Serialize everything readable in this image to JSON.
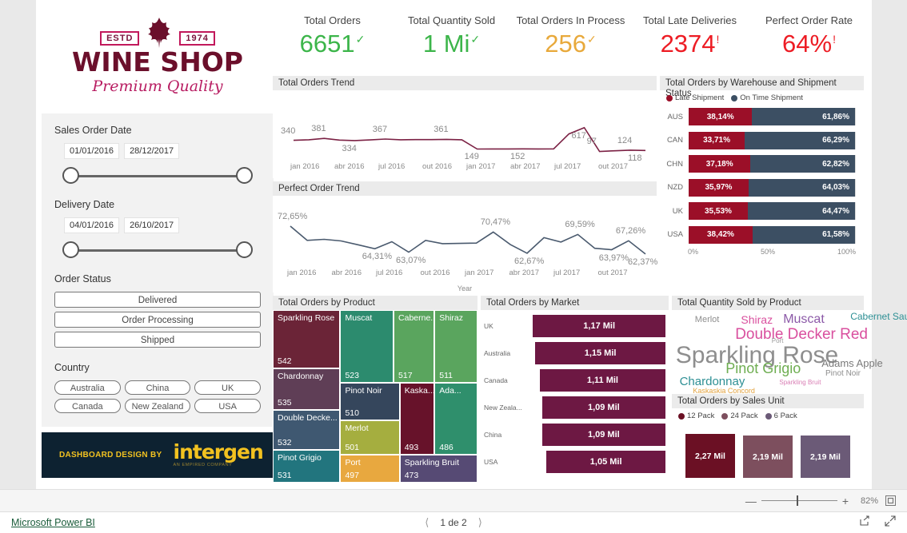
{
  "logo": {
    "estd": "ESTD",
    "year": "1974",
    "name": "WINE SHOP",
    "tagline": "Premium Quality",
    "leaf_icon": "leaf-icon",
    "color": "#6b0f2b",
    "accent": "#b81d62"
  },
  "filters": {
    "sales_order_date": {
      "label": "Sales Order Date",
      "start": "01/01/2016",
      "end": "28/12/2017"
    },
    "delivery_date": {
      "label": "Delivery Date",
      "start": "04/01/2016",
      "end": "26/10/2017"
    },
    "order_status": {
      "label": "Order Status",
      "options": [
        "Delivered",
        "Order Processing",
        "Shipped"
      ]
    },
    "country": {
      "label": "Country",
      "options": [
        "Australia",
        "China",
        "UK",
        "Canada",
        "New Zealand",
        "USA"
      ]
    }
  },
  "credit": {
    "prefix": "DASHBOARD DESIGN BY",
    "brand": "intergen",
    "sub": "AN EMPIRED COMPANY"
  },
  "kpis": [
    {
      "title": "Total Orders",
      "value": "6651",
      "flag": "check",
      "color": "#3cb54a"
    },
    {
      "title": "Total Quantity Sold",
      "value": "1 Mi",
      "flag": "check",
      "color": "#3cb54a"
    },
    {
      "title": "Total Orders In Process",
      "value": "256",
      "flag": "check",
      "color": "#e8a93b"
    },
    {
      "title": "Total Late Deliveries",
      "value": "2374",
      "flag": "alert",
      "color": "#ed1c24"
    },
    {
      "title": "Perfect Order Rate",
      "value": "64%",
      "flag": "alert",
      "color": "#ed1c24"
    }
  ],
  "chart_data": [
    {
      "type": "line",
      "title": "Total Orders Trend",
      "xlabel": "",
      "ylabel": "",
      "line_color": "#7b2144",
      "categories": [
        "jan 2016",
        "fev 2016",
        "mar 2016",
        "abr 2016",
        "mai 2016",
        "jun 2016",
        "jul 2016",
        "ago 2016",
        "set 2016",
        "out 2016",
        "nov 2016",
        "dez 2016",
        "jan 2017",
        "fev 2017",
        "mar 2017",
        "abr 2017",
        "mai 2017",
        "jun 2017",
        "jul 2017",
        "ago 2017",
        "set 2017",
        "out 2017",
        "nov 2017",
        "dez 2017"
      ],
      "tick_labels": [
        "jan 2016",
        "abr 2016",
        "jul 2016",
        "out 2016",
        "jan 2017",
        "abr 2017",
        "jul 2017",
        "out 2017"
      ],
      "values": [
        340,
        352,
        381,
        345,
        334,
        348,
        367,
        352,
        355,
        356,
        361,
        352,
        149,
        151,
        150,
        152,
        151,
        152,
        480,
        617,
        97,
        110,
        124,
        118
      ],
      "data_labels": [
        {
          "text": "340",
          "index": 0
        },
        {
          "text": "381",
          "index": 2
        },
        {
          "text": "334",
          "index": 4
        },
        {
          "text": "367",
          "index": 6
        },
        {
          "text": "361",
          "index": 10
        },
        {
          "text": "149",
          "index": 12
        },
        {
          "text": "152",
          "index": 15
        },
        {
          "text": "617",
          "index": 19
        },
        {
          "text": "97",
          "index": 20
        },
        {
          "text": "124",
          "index": 22
        },
        {
          "text": "118",
          "index": 23
        }
      ],
      "ylim": [
        0,
        700
      ]
    },
    {
      "type": "line",
      "title": "Perfect Order Trend",
      "xlabel": "Year",
      "ylabel": "",
      "line_color": "#4a5a6e",
      "tick_labels": [
        "jan 2016",
        "abr 2016",
        "jul 2016",
        "out 2016",
        "jan 2017",
        "abr 2017",
        "jul 2017",
        "out 2017"
      ],
      "categories": [
        "jan 2016",
        "fev 2016",
        "mar 2016",
        "abr 2016",
        "mai 2016",
        "jun 2016",
        "jul 2016",
        "ago 2016",
        "set 2016",
        "out 2016",
        "nov 2016",
        "dez 2016",
        "jan 2017",
        "fev 2017",
        "mar 2017",
        "abr 2017",
        "mai 2017",
        "jun 2017",
        "jul 2017",
        "ago 2017",
        "set 2017",
        "out 2017"
      ],
      "values": [
        72.65,
        67.4,
        67.8,
        67.2,
        65.8,
        64.31,
        66.9,
        63.07,
        67.4,
        66.2,
        66.3,
        66.4,
        70.47,
        65.9,
        62.67,
        68.4,
        66.8,
        69.59,
        64.5,
        63.97,
        67.26,
        62.37
      ],
      "data_labels": [
        {
          "text": "72,65%",
          "index": 0
        },
        {
          "text": "64,31%",
          "index": 5
        },
        {
          "text": "63,07%",
          "index": 7
        },
        {
          "text": "70,47%",
          "index": 12
        },
        {
          "text": "62,67%",
          "index": 14
        },
        {
          "text": "69,59%",
          "index": 17
        },
        {
          "text": "63,97%",
          "index": 19
        },
        {
          "text": "67,26%",
          "index": 20
        },
        {
          "text": "62,37%",
          "index": 21
        }
      ],
      "ylim": [
        60,
        75
      ]
    },
    {
      "type": "bar",
      "title": "Total Orders by Warehouse and Shipment Status",
      "orientation": "horizontal",
      "stacked": true,
      "legend": [
        "Late Shipment",
        "On Time Shipment"
      ],
      "legend_colors": [
        "#9b0f28",
        "#3c4f63"
      ],
      "categories": [
        "AUS",
        "CAN",
        "CHN",
        "NZD",
        "UK",
        "USA"
      ],
      "series": [
        {
          "name": "Late Shipment",
          "values": [
            38.14,
            33.71,
            37.18,
            35.97,
            35.53,
            38.42
          ],
          "labels": [
            "38,14%",
            "33,71%",
            "37,18%",
            "35,97%",
            "35,53%",
            "38,42%"
          ]
        },
        {
          "name": "On Time Shipment",
          "values": [
            61.86,
            66.29,
            62.82,
            64.03,
            64.47,
            61.58
          ],
          "labels": [
            "61,86%",
            "66,29%",
            "62,82%",
            "64,03%",
            "64,47%",
            "61,58%"
          ]
        }
      ],
      "axis_ticks": [
        "0%",
        "50%",
        "100%"
      ],
      "xlim": [
        0,
        100
      ]
    },
    {
      "type": "treemap",
      "title": "Total Orders by Product",
      "items": [
        {
          "label": "Sparkling Rose",
          "value": 542,
          "value_text": "542",
          "color": "#6b2437"
        },
        {
          "label": "Chardonnay",
          "value": 535,
          "value_text": "535",
          "color": "#5f3e56"
        },
        {
          "label": "Double Decke...",
          "value": 532,
          "value_text": "532",
          "color": "#3f5871"
        },
        {
          "label": "Pinot Grigio",
          "value": 531,
          "value_text": "531",
          "color": "#22757e"
        },
        {
          "label": "Muscat",
          "value": 523,
          "value_text": "523",
          "color": "#2c8b6e"
        },
        {
          "label": "Caberne...",
          "value": 517,
          "value_text": "517",
          "color": "#5aa55e"
        },
        {
          "label": "Shiraz",
          "value": 511,
          "value_text": "511",
          "color": "#5aa55e"
        },
        {
          "label": "Pinot Noir",
          "value": 510,
          "value_text": "510",
          "color": "#35465c"
        },
        {
          "label": "Merlot",
          "value": 501,
          "value_text": "501",
          "color": "#a5ae3f"
        },
        {
          "label": "Port",
          "value": 497,
          "value_text": "497",
          "color": "#e8a83f"
        },
        {
          "label": "Kaska...",
          "value": 493,
          "value_text": "493",
          "color": "#67122a"
        },
        {
          "label": "Ada...",
          "value": 486,
          "value_text": "486",
          "color": "#2f8f6c"
        },
        {
          "label": "Sparkling Bruit",
          "value": 473,
          "value_text": "473",
          "color": "#564a74"
        }
      ]
    },
    {
      "type": "bar",
      "title": "Total Orders by Market",
      "orientation": "horizontal",
      "bar_color": "#6d1843",
      "categories": [
        "UK",
        "Australia",
        "Canada",
        "New Zeala...",
        "China",
        "USA"
      ],
      "values": [
        1.17,
        1.15,
        1.11,
        1.09,
        1.09,
        1.05
      ],
      "value_labels": [
        "1,17 Mil",
        "1,15 Mil",
        "1,11 Mil",
        "1,09 Mil",
        "1,09 Mil",
        "1,05 Mil"
      ],
      "xlim": [
        0,
        1.25
      ]
    },
    {
      "type": "wordcloud",
      "title": "Total Quantity Sold by Product",
      "items": [
        {
          "text": "Sparkling Rose",
          "size": 30,
          "color": "#8e8e8e",
          "x": 2,
          "y": 40
        },
        {
          "text": "Double Decker Red",
          "size": 19,
          "color": "#d94f9e",
          "x": 33,
          "y": 20
        },
        {
          "text": "Pinot Grigio",
          "size": 18,
          "color": "#6fae52",
          "x": 28,
          "y": 62
        },
        {
          "text": "Chardonnay",
          "size": 15,
          "color": "#2d8f94",
          "x": 4,
          "y": 80
        },
        {
          "text": "Muscat",
          "size": 16,
          "color": "#8c5aa8",
          "x": 58,
          "y": 3
        },
        {
          "text": "Shiraz",
          "size": 14,
          "color": "#d94f9e",
          "x": 36,
          "y": 4
        },
        {
          "text": "Cabernet Sauvignon",
          "size": 12,
          "color": "#2d8f94",
          "x": 93,
          "y": 1
        },
        {
          "text": "Merlot",
          "size": 11,
          "color": "#8e8e8e",
          "x": 12,
          "y": 6
        },
        {
          "text": "Adams Apple",
          "size": 13,
          "color": "#7a7a7a",
          "x": 78,
          "y": 58
        },
        {
          "text": "Pinot Noir",
          "size": 10,
          "color": "#8e8e8e",
          "x": 80,
          "y": 73
        },
        {
          "text": "Sparkling Bruit",
          "size": 8,
          "color": "#d97fb5",
          "x": 56,
          "y": 85
        },
        {
          "text": "Kaskaskia Concord",
          "size": 9,
          "color": "#e3a33f",
          "x": 11,
          "y": 95
        },
        {
          "text": "Port",
          "size": 8,
          "color": "#9a9a9a",
          "x": 52,
          "y": 34
        }
      ]
    },
    {
      "type": "bar",
      "title": "Total Orders by Sales Unit",
      "legend": [
        "12 Pack",
        "24 Pack",
        "6 Pack"
      ],
      "legend_colors": [
        "#6b1024",
        "#7d4f5e",
        "#6b5a77"
      ],
      "categories": [
        "12 Pack",
        "24 Pack",
        "6 Pack"
      ],
      "values": [
        2.27,
        2.19,
        2.19
      ],
      "value_labels": [
        "2,27 Mil",
        "2,19 Mil",
        "2,19 Mil"
      ],
      "bar_colors": [
        "#6b1024",
        "#7d4f5e",
        "#6b5a77"
      ],
      "ylim": [
        0,
        2.4
      ]
    }
  ],
  "zoom_bar": {
    "percent": "82%",
    "minus_icon": "minus-icon",
    "plus_icon": "plus-icon",
    "fullscreen_icon": "fullscreen-icon"
  },
  "footer": {
    "brand": "Microsoft Power BI",
    "prev_icon": "chevron-left-icon",
    "page": "1 de 2",
    "next_icon": "chevron-right-icon",
    "share_icon": "share-icon",
    "expand_icon": "expand-icon"
  }
}
